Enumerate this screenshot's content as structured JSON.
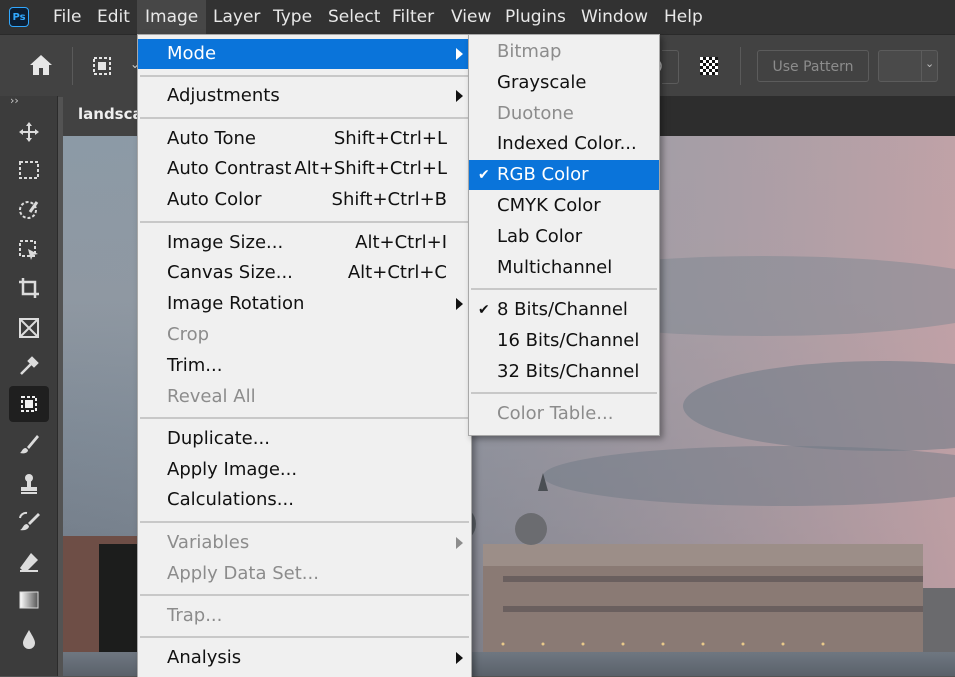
{
  "menubar": {
    "app_icon": "Ps",
    "items": [
      "File",
      "Edit",
      "Image",
      "Layer",
      "Type",
      "Select",
      "Filter",
      "View",
      "Plugins",
      "Window",
      "Help"
    ],
    "active": "Image"
  },
  "options_bar": {
    "home_icon": "home-icon",
    "tool_icon": "object-selection-icon",
    "pattern_preview": "checker-pattern-icon",
    "use_pattern_label": "Use Pattern"
  },
  "document": {
    "tab_title": "landscape"
  },
  "tools": [
    "move-icon",
    "marquee-icon",
    "quick-selection-icon",
    "object-selection-icon",
    "crop-icon",
    "frame-icon",
    "eyedropper-icon",
    "patch-icon",
    "brush-icon",
    "stamp-icon",
    "history-brush-icon",
    "eraser-icon",
    "gradient-icon",
    "blur-icon"
  ],
  "image_menu": {
    "items": [
      {
        "label": "Mode",
        "submenu": true,
        "highlighted": true
      },
      {
        "sep": true
      },
      {
        "label": "Adjustments",
        "submenu": true
      },
      {
        "sep": true
      },
      {
        "label": "Auto Tone",
        "shortcut": "Shift+Ctrl+L"
      },
      {
        "label": "Auto Contrast",
        "shortcut": "Alt+Shift+Ctrl+L"
      },
      {
        "label": "Auto Color",
        "shortcut": "Shift+Ctrl+B"
      },
      {
        "sep": true
      },
      {
        "label": "Image Size...",
        "shortcut": "Alt+Ctrl+I"
      },
      {
        "label": "Canvas Size...",
        "shortcut": "Alt+Ctrl+C"
      },
      {
        "label": "Image Rotation",
        "submenu": true
      },
      {
        "label": "Crop",
        "disabled": true
      },
      {
        "label": "Trim..."
      },
      {
        "label": "Reveal All",
        "disabled": true
      },
      {
        "sep": true
      },
      {
        "label": "Duplicate..."
      },
      {
        "label": "Apply Image..."
      },
      {
        "label": "Calculations..."
      },
      {
        "sep": true
      },
      {
        "label": "Variables",
        "submenu": true,
        "disabled": true
      },
      {
        "label": "Apply Data Set...",
        "disabled": true
      },
      {
        "sep": true
      },
      {
        "label": "Trap...",
        "disabled": true
      },
      {
        "sep": true
      },
      {
        "label": "Analysis",
        "submenu": true
      }
    ]
  },
  "mode_submenu": {
    "items": [
      {
        "label": "Bitmap",
        "disabled": true
      },
      {
        "label": "Grayscale"
      },
      {
        "label": "Duotone",
        "disabled": true
      },
      {
        "label": "Indexed Color..."
      },
      {
        "label": "RGB Color",
        "checked": true,
        "highlighted": true
      },
      {
        "label": "CMYK Color"
      },
      {
        "label": "Lab Color"
      },
      {
        "label": "Multichannel"
      },
      {
        "sep": true
      },
      {
        "label": "8 Bits/Channel",
        "checked": true
      },
      {
        "label": "16 Bits/Channel"
      },
      {
        "label": "32 Bits/Channel"
      },
      {
        "sep": true
      },
      {
        "label": "Color Table...",
        "disabled": true
      }
    ]
  },
  "colors": {
    "menubar_bg": "#323232",
    "menu_bg": "#f0f0f0",
    "highlight": "#0a74da",
    "disabled_text": "#8c8c8c"
  }
}
